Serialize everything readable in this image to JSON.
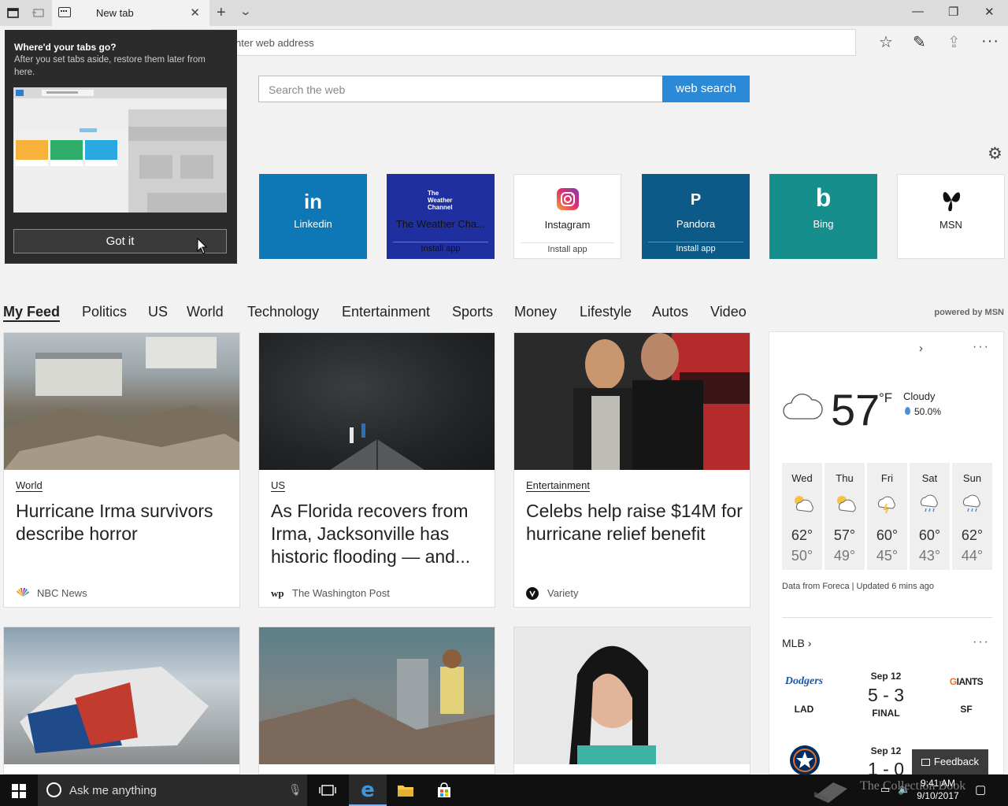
{
  "browser": {
    "tab_title": "New tab",
    "address_placeholder": "nter web address"
  },
  "search": {
    "placeholder": "Search the web",
    "button": "web search"
  },
  "popup": {
    "title": "Where'd your tabs go?",
    "body": "After you set tabs aside, restore them later from here.",
    "button": "Got it"
  },
  "tiles": [
    {
      "label": "Linkedin",
      "logo": "in",
      "install": "",
      "color": "#0e77b5"
    },
    {
      "label": "The Weather Cha...",
      "logo": "The Weather Channel",
      "install": "Install app",
      "color": "#1f2fa0"
    },
    {
      "label": "Instagram",
      "logo": "instagram-icon",
      "install": "Install app",
      "color": "#ffffff"
    },
    {
      "label": "Pandora",
      "logo": "P",
      "install": "Install app",
      "color": "#0b5a88"
    },
    {
      "label": "Bing",
      "logo": "b",
      "install": "",
      "color": "#168f8c"
    },
    {
      "label": "MSN",
      "logo": "msn-butterfly-icon",
      "install": "",
      "color": "#ffffff"
    }
  ],
  "categories": [
    "My Feed",
    "Politics",
    "US",
    "World",
    "Technology",
    "Entertainment",
    "Sports",
    "Money",
    "Lifestyle",
    "Autos",
    "Video"
  ],
  "powered_by": "powered by MSN",
  "articles": [
    {
      "category": "World",
      "title": "Hurricane Irma survivors describe horror",
      "source": "NBC News"
    },
    {
      "category": "US",
      "title": "As Florida recovers from Irma, Jacksonville has historic flooding — and...",
      "source": "The Washington Post"
    },
    {
      "category": "Entertainment",
      "title": "Celebs help raise $14M for hurricane relief benefit",
      "source": "Variety"
    }
  ],
  "weather": {
    "temp": "57",
    "unit": "°F",
    "condition": "Cloudy",
    "precip": "50.0%",
    "forecast": [
      {
        "day": "Wed",
        "high": "62°",
        "low": "50°",
        "icon": "partly-sunny-icon"
      },
      {
        "day": "Thu",
        "high": "57°",
        "low": "49°",
        "icon": "partly-sunny-icon"
      },
      {
        "day": "Fri",
        "high": "60°",
        "low": "45°",
        "icon": "thunderstorm-icon"
      },
      {
        "day": "Sat",
        "high": "60°",
        "low": "43°",
        "icon": "rain-icon"
      },
      {
        "day": "Sun",
        "high": "62°",
        "low": "44°",
        "icon": "rain-icon"
      }
    ],
    "footer": "Data from Foreca | Updated 6 mins ago"
  },
  "mlb": {
    "title": "MLB",
    "games": [
      {
        "date": "Sep 12",
        "score": "5 - 3",
        "status": "FINAL",
        "home": "LAD",
        "away": "SF"
      },
      {
        "date": "Sep 12",
        "score": "1 - 0",
        "status": "",
        "home": "",
        "away": ""
      }
    ]
  },
  "feedback": "Feedback",
  "taskbar": {
    "search_placeholder": "Ask me anything",
    "time": "9:41 AM",
    "date": "9/10/2017"
  },
  "watermark": "The Collection Book"
}
